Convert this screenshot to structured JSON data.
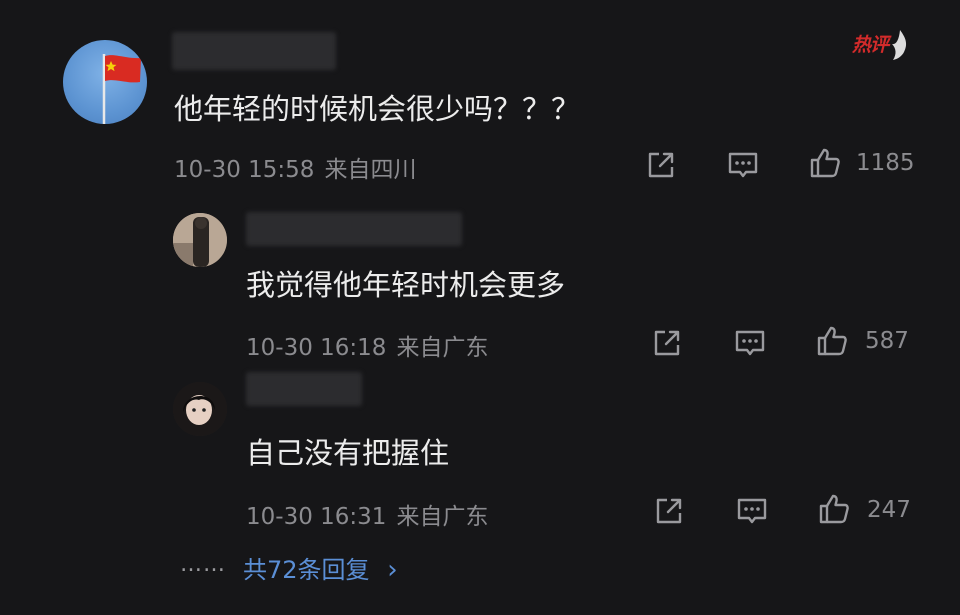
{
  "watermark": {
    "text": "热评"
  },
  "comments": [
    {
      "text": "他年轻的时候机会很少吗？？？",
      "time": "10-30 15:58",
      "location": "来自四川",
      "likes": "1185"
    },
    {
      "text": "我觉得他年轻时机会更多",
      "time": "10-30 16:18",
      "location": "来自广东",
      "likes": "587"
    },
    {
      "text": "自己没有把握住",
      "time": "10-30 16:31",
      "location": "来自广东",
      "likes": "247"
    }
  ],
  "replies_footer": {
    "dots": "……",
    "label": "共72条回复",
    "chevron": "›"
  },
  "icons": {
    "share": "share-icon",
    "reply": "comment-icon",
    "like": "thumbs-up-icon"
  },
  "colors": {
    "background": "#161618",
    "text": "#ececec",
    "meta": "#8b8b8f",
    "link": "#5b8fd6",
    "watermark": "#d22b2b"
  }
}
